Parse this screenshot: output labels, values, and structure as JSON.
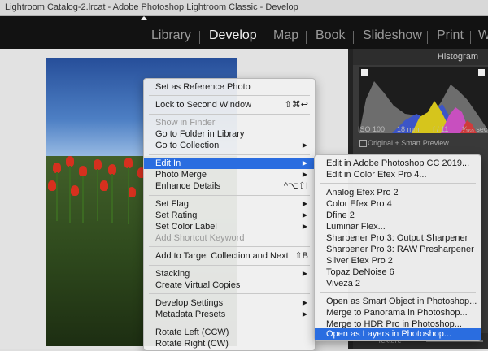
{
  "window": {
    "title": "Lightroom Catalog-2.lrcat - Adobe Photoshop Lightroom Classic - Develop"
  },
  "modules": [
    {
      "label": "Library",
      "active": false
    },
    {
      "label": "Develop",
      "active": true
    },
    {
      "label": "Map",
      "active": false
    },
    {
      "label": "Book",
      "active": false
    },
    {
      "label": "Slideshow",
      "active": false
    },
    {
      "label": "Print",
      "active": false
    },
    {
      "label": "W",
      "active": false
    }
  ],
  "histogram": {
    "title": "Histogram",
    "iso": "ISO 100",
    "focal": "18 mm",
    "aperture": "f / 11",
    "shutter": "¹⁄₁₆₀ sec",
    "preview_label": "Original + Smart Preview"
  },
  "texture_label": "Texture",
  "context_menu": {
    "items": [
      {
        "label": "Set as Reference Photo",
        "shortcut": "",
        "submenu": false,
        "disabled": false
      },
      {
        "label": "Lock to Second Window",
        "shortcut": "⇧⌘↩",
        "submenu": false,
        "disabled": false
      },
      {
        "label": "Show in Finder",
        "shortcut": "",
        "submenu": false,
        "disabled": true
      },
      {
        "label": "Go to Folder in Library",
        "shortcut": "",
        "submenu": false,
        "disabled": false
      },
      {
        "label": "Go to Collection",
        "shortcut": "",
        "submenu": true,
        "disabled": false
      },
      {
        "label": "Edit In",
        "shortcut": "",
        "submenu": true,
        "disabled": false,
        "highlighted": true
      },
      {
        "label": "Photo Merge",
        "shortcut": "",
        "submenu": true,
        "disabled": false
      },
      {
        "label": "Enhance Details",
        "shortcut": "^⌥⇧I",
        "submenu": false,
        "disabled": false
      },
      {
        "label": "Set Flag",
        "shortcut": "",
        "submenu": true,
        "disabled": false
      },
      {
        "label": "Set Rating",
        "shortcut": "",
        "submenu": true,
        "disabled": false
      },
      {
        "label": "Set Color Label",
        "shortcut": "",
        "submenu": true,
        "disabled": false
      },
      {
        "label": "Add Shortcut Keyword",
        "shortcut": "",
        "submenu": false,
        "disabled": true
      },
      {
        "label": "Add to Target Collection and Next",
        "shortcut": "⇧B",
        "submenu": false,
        "disabled": false
      },
      {
        "label": "Stacking",
        "shortcut": "",
        "submenu": true,
        "disabled": false
      },
      {
        "label": "Create Virtual Copies",
        "shortcut": "",
        "submenu": false,
        "disabled": false
      },
      {
        "label": "Develop Settings",
        "shortcut": "",
        "submenu": true,
        "disabled": false
      },
      {
        "label": "Metadata Presets",
        "shortcut": "",
        "submenu": true,
        "disabled": false
      },
      {
        "label": "Rotate Left (CCW)",
        "shortcut": "",
        "submenu": false,
        "disabled": false
      },
      {
        "label": "Rotate Right (CW)",
        "shortcut": "",
        "submenu": false,
        "disabled": false
      }
    ]
  },
  "edit_in_submenu": {
    "items": [
      {
        "label": "Edit in Adobe Photoshop CC 2019..."
      },
      {
        "label": "Edit in Color Efex Pro 4..."
      },
      {
        "label": "Analog Efex Pro 2"
      },
      {
        "label": "Color Efex Pro 4"
      },
      {
        "label": "Dfine 2"
      },
      {
        "label": "Luminar Flex..."
      },
      {
        "label": "Sharpener Pro 3: Output Sharpener"
      },
      {
        "label": "Sharpener Pro 3: RAW Presharpener"
      },
      {
        "label": "Silver Efex Pro 2"
      },
      {
        "label": "Topaz DeNoise 6"
      },
      {
        "label": "Viveza 2"
      },
      {
        "label": "Open as Smart Object in Photoshop..."
      },
      {
        "label": "Merge to Panorama in Photoshop..."
      },
      {
        "label": "Merge to HDR Pro in Photoshop..."
      },
      {
        "label": "Open as Layers in Photoshop...",
        "highlighted": true
      }
    ]
  },
  "colors": {
    "highlight": "#2a6de0",
    "module_bar": "#121212",
    "panel": "#393939"
  }
}
